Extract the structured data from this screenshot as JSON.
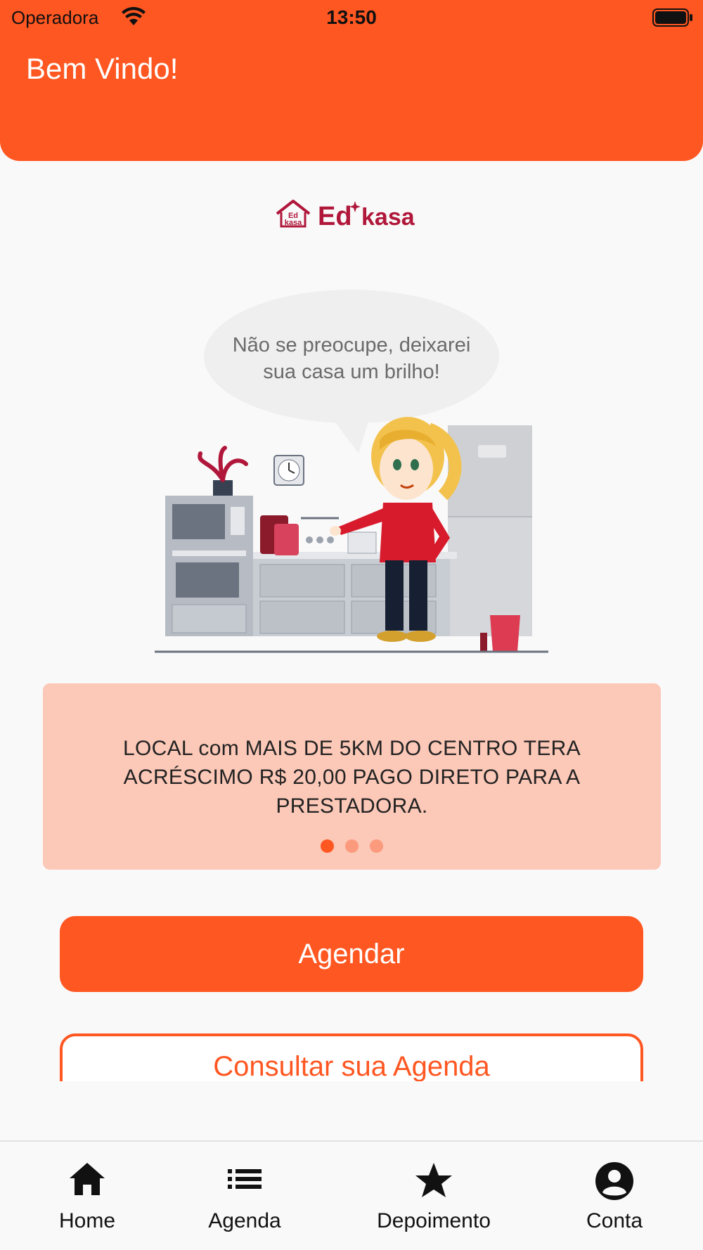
{
  "status_bar": {
    "carrier": "Operadora",
    "time": "13:50"
  },
  "header": {
    "title": "Bem Vindo!"
  },
  "logo": {
    "text_left": "Ed",
    "text_right": "kasa",
    "house_text_top": "Ed",
    "house_text_bottom": "kasa"
  },
  "speech_bubble": {
    "line1": "Não se preocupe, deixarei",
    "line2": "sua casa um brilho!"
  },
  "banner": {
    "message": "LOCAL com MAIS DE 5KM DO CENTRO TERA ACRÉSCIMO R$ 20,00 PAGO DIRETO PARA A PRESTADORA.",
    "page_count": 3,
    "active_page": 1
  },
  "buttons": {
    "schedule": "Agendar",
    "view_schedule": "Consultar sua Agenda"
  },
  "tabbar": {
    "items": [
      {
        "label": "Home",
        "icon": "home-icon"
      },
      {
        "label": "Agenda",
        "icon": "list-icon"
      },
      {
        "label": "Depoimento",
        "icon": "star-icon"
      },
      {
        "label": "Conta",
        "icon": "account-circle-icon"
      }
    ]
  },
  "colors": {
    "primary": "#ff5722",
    "banner_bg": "#fcc8b7",
    "logo_red": "#b0173a"
  }
}
